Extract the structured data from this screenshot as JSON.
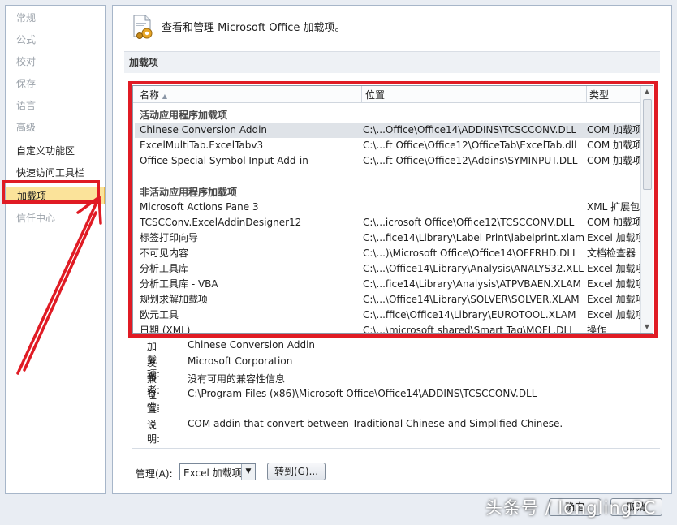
{
  "nav": {
    "items": [
      {
        "label": "常规"
      },
      {
        "label": "公式"
      },
      {
        "label": "校对"
      },
      {
        "label": "保存"
      },
      {
        "label": "语言"
      },
      {
        "label": "高级"
      },
      {
        "label": "自定义功能区"
      },
      {
        "label": "快速访问工具栏"
      },
      {
        "label": "加载项"
      },
      {
        "label": "信任中心"
      }
    ]
  },
  "header": {
    "title": "查看和管理 Microsoft Office 加载项。"
  },
  "section": {
    "title": "加载项"
  },
  "list": {
    "columns": {
      "name": "名称",
      "location": "位置",
      "type": "类型"
    },
    "sort_glyph": "▲",
    "active_group": "活动应用程序加载项",
    "active": [
      {
        "name": "Chinese Conversion Addin",
        "location": "C:\\...Office\\Office14\\ADDINS\\TCSCCONV.DLL",
        "type": "COM 加载项"
      },
      {
        "name": "ExcelMultiTab.ExcelTabv3",
        "location": "C:\\...ft Office\\Office12\\OfficeTab\\ExcelTab.dll",
        "type": "COM 加载项"
      },
      {
        "name": "Office Special Symbol Input Add-in",
        "location": "C:\\...ft Office\\Office12\\Addins\\SYMINPUT.DLL",
        "type": "COM 加载项"
      }
    ],
    "inactive_group": "非活动应用程序加载项",
    "inactive": [
      {
        "name": "Microsoft Actions Pane 3",
        "location": "",
        "type": "XML 扩展包"
      },
      {
        "name": "TCSCConv.ExcelAddinDesigner12",
        "location": "C:\\...icrosoft Office\\Office12\\TCSCCONV.DLL",
        "type": "COM 加载项"
      },
      {
        "name": "标签打印向导",
        "location": "C:\\...fice14\\Library\\Label Print\\labelprint.xlam",
        "type": "Excel 加载项"
      },
      {
        "name": "不可见内容",
        "location": "C:\\...)\\Microsoft Office\\Office14\\OFFRHD.DLL",
        "type": "文档检查器"
      },
      {
        "name": "分析工具库",
        "location": "C:\\...\\Office14\\Library\\Analysis\\ANALYS32.XLL",
        "type": "Excel 加载项"
      },
      {
        "name": "分析工具库 - VBA",
        "location": "C:\\...fice14\\Library\\Analysis\\ATPVBAEN.XLAM",
        "type": "Excel 加载项"
      },
      {
        "name": "规划求解加载项",
        "location": "C:\\...\\Office14\\Library\\SOLVER\\SOLVER.XLAM",
        "type": "Excel 加载项"
      },
      {
        "name": "欧元工具",
        "location": "C:\\...ffice\\Office14\\Library\\EUROTOOL.XLAM",
        "type": "Excel 加载项"
      },
      {
        "name": "日期 (XML)",
        "location": "C:\\...\\microsoft shared\\Smart Tag\\MOFL.DLL",
        "type": "操作"
      }
    ]
  },
  "details": {
    "addin_label": "加载项:",
    "addin_value": "Chinese Conversion Addin",
    "publisher_label": "发布者:",
    "publisher_value": "Microsoft Corporation",
    "compat_label": "兼容性:",
    "compat_value": "没有可用的兼容性信息",
    "location_label": "位置:",
    "location_value": "C:\\Program Files (x86)\\Microsoft Office\\Office14\\ADDINS\\TCSCCONV.DLL",
    "desc_label": "说明:",
    "desc_value": "COM addin that convert between Traditional Chinese and Simplified Chinese."
  },
  "manage": {
    "label": "管理(A):",
    "selected": "Excel 加载项",
    "go_label": "转到(G)..."
  },
  "footer": {
    "ok_label": "确定",
    "cancel_label": "取消"
  },
  "watermark": "头条号 / longlingPC",
  "colors": {
    "highlight": "#e01b24",
    "selected_nav": "#fbe39a"
  }
}
